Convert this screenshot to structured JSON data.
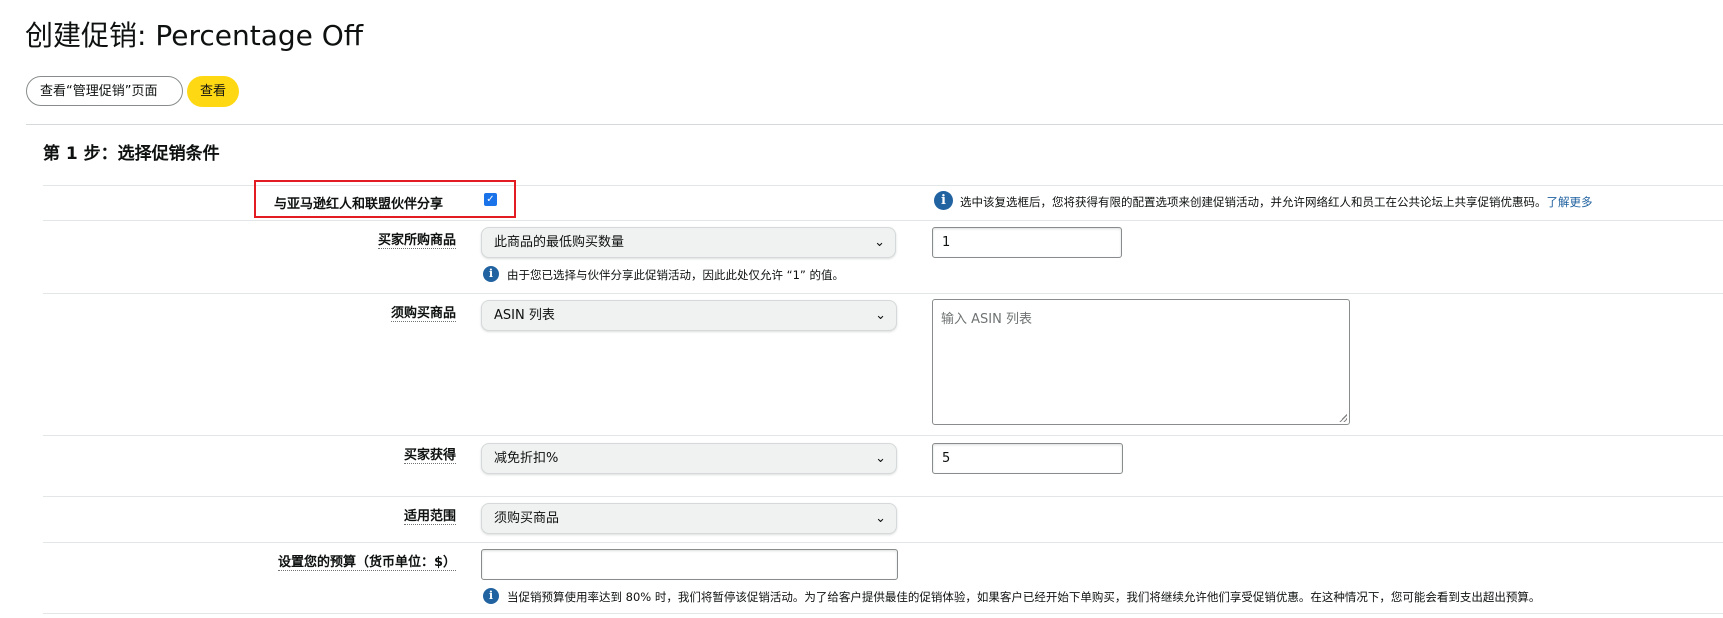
{
  "page_title": "创建促销: Percentage Off",
  "header_buttons": {
    "view_manage": "查看“管理促销”页面",
    "view": "查看"
  },
  "step_title": "第 1 步：选择促销条件",
  "share_row": {
    "label": "与亚马逊红人和联盟伙伴分享",
    "checked": true,
    "info_text": "选中该复选框后，您将获得有限的配置选项来创建促销活动，并允许网络红人和员工在公共论坛上共享促销优惠码。",
    "learn_more": "了解更多"
  },
  "buyer_purchases": {
    "label": "买家所购商品",
    "select_value": "此商品的最低购买数量",
    "input_value": "1",
    "note": "由于您已选择与伙伴分享此促销活动，因此此处仅允许 “1” 的值。"
  },
  "purchased_items": {
    "label": "须购买商品",
    "select_value": "ASIN 列表",
    "textarea_placeholder": "输入 ASIN 列表"
  },
  "buyer_gets": {
    "label": "买家获得",
    "select_value": "减免折扣%",
    "input_value": "5"
  },
  "applies_to": {
    "label": "适用范围",
    "select_value": "须购买商品"
  },
  "budget": {
    "label": "设置您的预算（货币单位：$）",
    "input_value": "",
    "note": "当促销预算使用率达到 80% 时，我们将暂停该促销活动。为了给客户提供最佳的促销体验，如果客户已经开始下单购买，我们将继续允许他们享受促销优惠。在这种情况下，您可能会看到支出超出预算。"
  },
  "colors": {
    "accent_yellow": "#ffd814",
    "link_blue": "#2162a1",
    "highlight_red": "#e31b23"
  },
  "icons": [
    "info-icon",
    "chevron-down-icon",
    "checkbox-checked-icon"
  ]
}
